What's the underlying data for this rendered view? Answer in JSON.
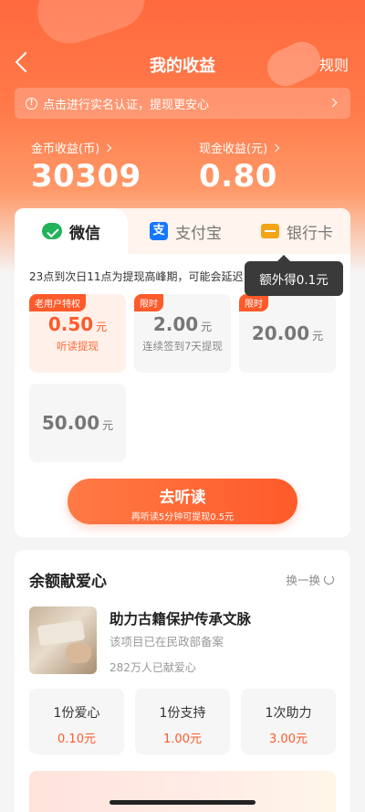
{
  "header": {
    "title": "我的收益",
    "rules": "规则"
  },
  "notice": {
    "text": "点击进行实名认证，提现更安心"
  },
  "earnings": {
    "coin_label": "金币收益(币)",
    "coin_value": "30309",
    "cash_label": "现金收益(元)",
    "cash_value": "0.80"
  },
  "tabs": [
    {
      "label": "微信",
      "icon": "wechat-icon",
      "active": true
    },
    {
      "label": "支付宝",
      "icon": "alipay-icon",
      "active": false
    },
    {
      "label": "银行卡",
      "icon": "bank-card-icon",
      "active": false
    }
  ],
  "peak_notice": "23点到次日11点为提现高峰期，可能会延迟",
  "tooltip": "额外得0.1元",
  "options": [
    {
      "tag": "老用户特权",
      "amount": "0.50",
      "unit": "元",
      "sub": "听读提现",
      "selected": true
    },
    {
      "tag": "限时",
      "amount": "2.00",
      "unit": "元",
      "sub": "连续签到7天提现",
      "selected": false
    },
    {
      "tag": "限时",
      "amount": "20.00",
      "unit": "元",
      "sub": "",
      "selected": false
    },
    {
      "tag": "",
      "amount": "50.00",
      "unit": "元",
      "sub": "",
      "selected": false
    }
  ],
  "listen_button": {
    "label": "去听读",
    "sub": "再听读5分钟可提现0.5元"
  },
  "charity": {
    "title": "余额献爱心",
    "swap": "换一换",
    "project": {
      "name": "助力古籍保护传承文脉",
      "desc": "该项目已在民政部备案",
      "count": "282万人已献爱心"
    },
    "donations": [
      {
        "label": "1份爱心",
        "price": "0.10元"
      },
      {
        "label": "1份支持",
        "price": "1.00元"
      },
      {
        "label": "1次助力",
        "price": "3.00元"
      }
    ]
  },
  "colors": {
    "accent": "#ff5a2a",
    "wechat": "#21b35a",
    "alipay": "#1677ff"
  }
}
